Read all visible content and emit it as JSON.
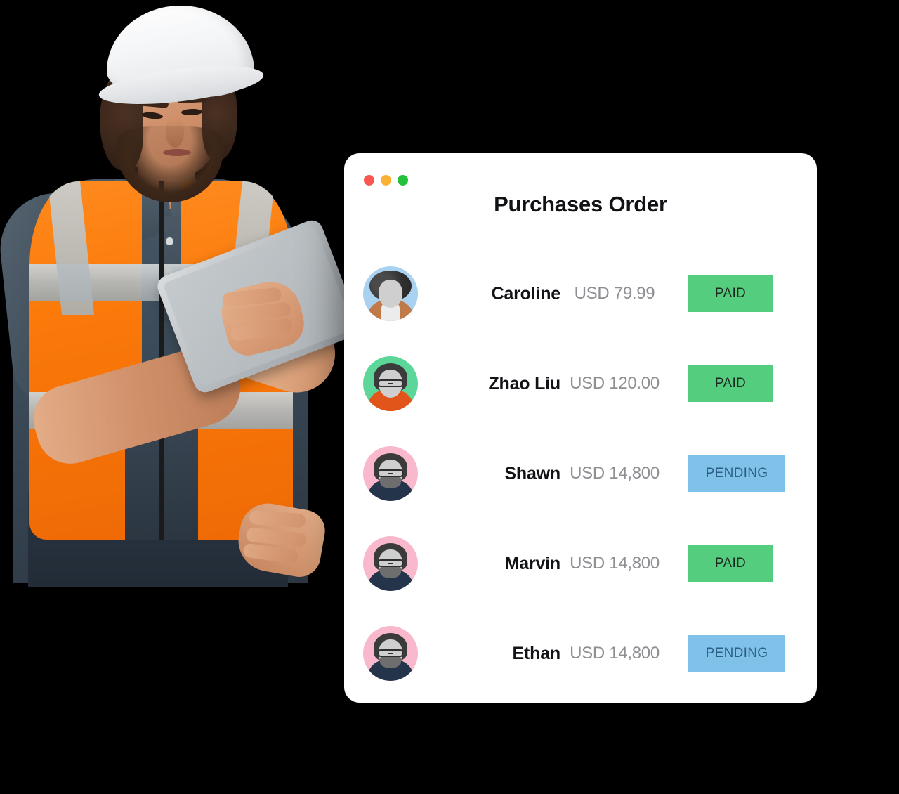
{
  "window": {
    "traffic_lights": [
      {
        "name": "close",
        "color": "#f9564f"
      },
      {
        "name": "minimize",
        "color": "#f9b233"
      },
      {
        "name": "maximize",
        "color": "#24c03a"
      }
    ]
  },
  "card": {
    "title": "Purchases Order"
  },
  "orders": [
    {
      "name": "Caroline",
      "amount": "USD 79.99",
      "status": "PAID",
      "status_type": "paid",
      "avatar": {
        "bg": "#a8d2f0",
        "style": "curly-jacket",
        "body_class": "jacket",
        "glasses": false,
        "beard": false
      }
    },
    {
      "name": "Zhao Liu",
      "amount": "USD 120.00",
      "status": "PAID",
      "status_type": "paid",
      "avatar": {
        "bg": "#5dd69a",
        "style": "glasses-orange",
        "body_class": "orange",
        "glasses": true,
        "beard": false
      }
    },
    {
      "name": "Shawn",
      "amount": "USD 14,800",
      "status": "PENDING",
      "status_type": "pending",
      "avatar": {
        "bg": "#f9b8cb",
        "style": "glasses-beard-navy",
        "body_class": "navy",
        "glasses": true,
        "beard": true
      }
    },
    {
      "name": "Marvin",
      "amount": "USD 14,800",
      "status": "PAID",
      "status_type": "paid",
      "avatar": {
        "bg": "#f9b8cb",
        "style": "glasses-beard-navy",
        "body_class": "navy",
        "glasses": true,
        "beard": true
      }
    },
    {
      "name": "Ethan",
      "amount": "USD 14,800",
      "status": "PENDING",
      "status_type": "pending",
      "avatar": {
        "bg": "#f9b8cb",
        "style": "glasses-beard-navy",
        "body_class": "navy",
        "glasses": true,
        "beard": true
      }
    }
  ],
  "illustration": {
    "subject": "construction-worker-with-tablet",
    "helmet_color": "#ffffff",
    "vest_color": "#fb7a0a",
    "shirt_color": "#3e4d5a",
    "tablet_color": "#b9bec2"
  },
  "colors": {
    "background": "#000000",
    "card_background": "#ffffff",
    "paid_badge": "#55cd7f",
    "paid_text": "#1d2a22",
    "pending_badge": "#7fc1e9",
    "pending_text": "#2d5f86",
    "name_text": "#121317",
    "amount_text": "#8d8f93",
    "title_text": "#111215"
  }
}
